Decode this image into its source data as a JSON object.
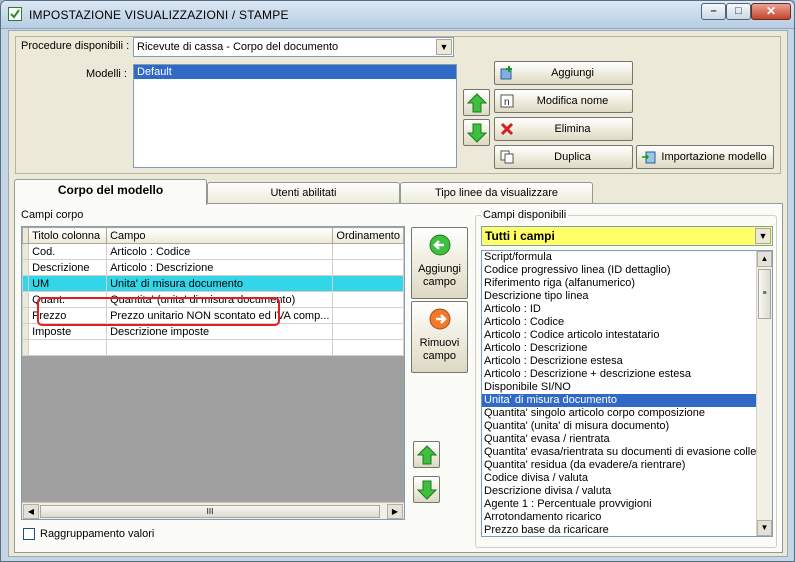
{
  "window": {
    "title": "IMPOSTAZIONE VISUALIZZAZIONI / STAMPE",
    "controls": {
      "minimize": "–",
      "maximize": "□",
      "close": "✕"
    }
  },
  "top": {
    "procedure_label": "Procedure disponibili :",
    "procedure_value": "Ricevute di cassa - Corpo del documento",
    "modelli_label": "Modelli :",
    "modelli": [
      "Default"
    ],
    "buttons": {
      "aggiungi": "Aggiungi",
      "modifica_nome": "Modifica nome",
      "elimina": "Elimina",
      "duplica": "Duplica",
      "importazione_modello": "Importazione modello"
    }
  },
  "tabs": [
    "Corpo del modello",
    "Utenti abilitati",
    "Tipo linee da visualizzare"
  ],
  "campi_corpo": {
    "label": "Campi corpo",
    "columns": [
      "Titolo colonna",
      "Campo",
      "Ordinamento"
    ],
    "rows": [
      {
        "titolo": "Cod.",
        "campo": "Articolo : Codice"
      },
      {
        "titolo": "Descrizione",
        "campo": "Articolo : Descrizione"
      },
      {
        "titolo": "UM",
        "campo": "Unita' di misura documento"
      },
      {
        "titolo": "Quant.",
        "campo": "Quantita' (unita' di misura documento)"
      },
      {
        "titolo": "Prezzo",
        "campo": "Prezzo unitario NON scontato ed IVA comp..."
      },
      {
        "titolo": "Imposte",
        "campo": "Descrizione imposte"
      }
    ],
    "scroll_thumb": "III"
  },
  "actions": {
    "aggiungi_campo": "Aggiungi campo",
    "rimuovi_campo": "Rimuovi campo"
  },
  "raggruppamento": "Raggruppamento valori",
  "campi_disponibili": {
    "label": "Campi disponibili",
    "filter": "Tutti i campi",
    "items": [
      "Script/formula",
      "Codice progressivo linea (ID dettaglio)",
      "Riferimento riga (alfanumerico)",
      "Descrizione tipo linea",
      "Articolo : ID",
      "Articolo : Codice",
      "Articolo : Codice articolo intestatario",
      "Articolo : Descrizione",
      "Articolo : Descrizione estesa",
      "Articolo : Descrizione + descrizione estesa",
      "Disponibile SI/NO",
      "Unita' di misura documento",
      "Quantita' singolo articolo corpo composizione",
      "Quantita' (unita' di misura documento)",
      "Quantita' evasa / rientrata",
      "Quantita' evasa/rientrata su documenti di evasione collegati",
      "Quantita' residua (da evadere/a rientrare)",
      "Codice divisa / valuta",
      "Descrizione divisa / valuta",
      "Agente 1 : Percentuale provvigioni",
      "Arrotondamento ricarico",
      "Prezzo base da ricaricare"
    ],
    "selected_index": 11
  },
  "colors": {
    "accent": "#3169c6",
    "highlight_row": "#33d6e8",
    "filter_bg": "#ffff66",
    "annotation": "#e02020"
  }
}
